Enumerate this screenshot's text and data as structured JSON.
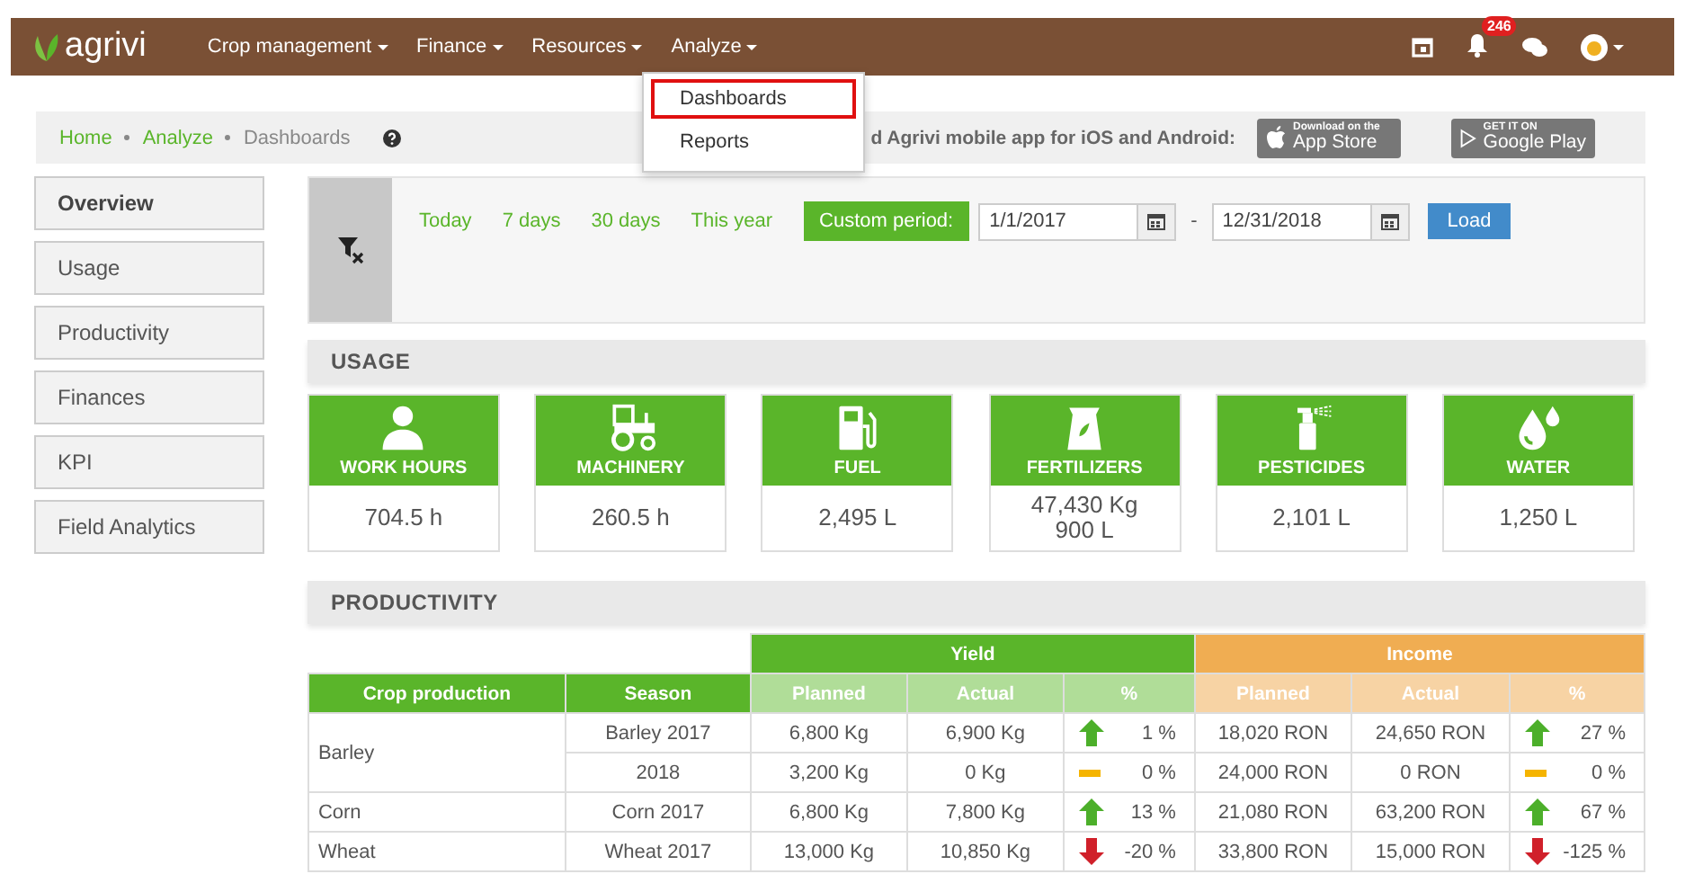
{
  "nav": {
    "logo": "agrivi",
    "menus": [
      {
        "label": "Crop management"
      },
      {
        "label": "Finance"
      },
      {
        "label": "Resources"
      },
      {
        "label": "Analyze",
        "dropdown": [
          {
            "label": "Dashboards",
            "selected": true
          },
          {
            "label": "Reports",
            "selected": false
          }
        ]
      }
    ],
    "notification_count": "246"
  },
  "breadcrumb": {
    "items": [
      {
        "label": "Home",
        "kind": "link"
      },
      {
        "label": "Analyze",
        "kind": "link"
      },
      {
        "label": "Dashboards",
        "kind": "current"
      }
    ],
    "banner": "d Agrivi mobile app for iOS and Android:",
    "stores": [
      {
        "kind": "apple",
        "small": "Download on the",
        "name": "App Store"
      },
      {
        "kind": "google",
        "small": "GET IT ON",
        "name": "Google Play"
      }
    ]
  },
  "sidebar": {
    "items": [
      {
        "label": "Overview",
        "selected": true
      },
      {
        "label": "Usage",
        "selected": false
      },
      {
        "label": "Productivity",
        "selected": false
      },
      {
        "label": "Finances",
        "selected": false
      },
      {
        "label": "KPI",
        "selected": false
      },
      {
        "label": "Field Analytics",
        "selected": false
      }
    ]
  },
  "filter": {
    "periods": [
      {
        "label": "Today",
        "selected": false
      },
      {
        "label": "7 days",
        "selected": false
      },
      {
        "label": "30 days",
        "selected": false
      },
      {
        "label": "This year",
        "selected": false
      },
      {
        "label": "Custom period:",
        "selected": true
      }
    ],
    "from": "1/1/2017",
    "separator": "-",
    "to": "12/31/2018",
    "button": "Load"
  },
  "usage": {
    "title": "USAGE",
    "cards": [
      {
        "kind": "person",
        "label": "WORK HOURS",
        "values": [
          "704.5 h"
        ]
      },
      {
        "kind": "tractor",
        "label": "MACHINERY",
        "values": [
          "260.5 h"
        ]
      },
      {
        "kind": "fuel",
        "label": "FUEL",
        "values": [
          "2,495 L"
        ]
      },
      {
        "kind": "bag",
        "label": "FERTILIZERS",
        "values": [
          "47,430 Kg",
          "900 L"
        ]
      },
      {
        "kind": "spray",
        "label": "PESTICIDES",
        "values": [
          "2,101 L"
        ]
      },
      {
        "kind": "water",
        "label": "WATER",
        "values": [
          "1,250 L"
        ]
      }
    ]
  },
  "productivity": {
    "title": "PRODUCTIVITY",
    "groups": [
      "Yield",
      "Income"
    ],
    "columns": [
      "Crop production",
      "Season",
      "Planned",
      "Actual",
      "%",
      "Planned",
      "Actual",
      "%"
    ],
    "crops": [
      {
        "crop": "Barley",
        "seasons": [
          {
            "season": "Barley 2017",
            "yield": {
              "planned": "6,800 Kg",
              "actual": "6,900 Kg",
              "kind": "up",
              "percent": "1 %"
            },
            "income": {
              "planned": "18,020 RON",
              "actual": "24,650 RON",
              "kind": "up",
              "percent": "27 %"
            }
          },
          {
            "season": "2018",
            "yield": {
              "planned": "3,200 Kg",
              "actual": "0 Kg",
              "kind": "flat",
              "percent": "0 %"
            },
            "income": {
              "planned": "24,000 RON",
              "actual": "0 RON",
              "kind": "flat",
              "percent": "0 %"
            }
          }
        ]
      },
      {
        "crop": "Corn",
        "seasons": [
          {
            "season": "Corn 2017",
            "yield": {
              "planned": "6,800 Kg",
              "actual": "7,800 Kg",
              "kind": "up",
              "percent": "13 %"
            },
            "income": {
              "planned": "21,080 RON",
              "actual": "63,200 RON",
              "kind": "up",
              "percent": "67 %"
            }
          }
        ]
      },
      {
        "crop": "Wheat",
        "seasons": [
          {
            "season": "Wheat 2017",
            "yield": {
              "planned": "13,000 Kg",
              "actual": "10,850 Kg",
              "kind": "down",
              "percent": "-20 %"
            },
            "income": {
              "planned": "33,800 RON",
              "actual": "15,000 RON",
              "kind": "down",
              "percent": "-125 %"
            }
          }
        ]
      }
    ]
  }
}
